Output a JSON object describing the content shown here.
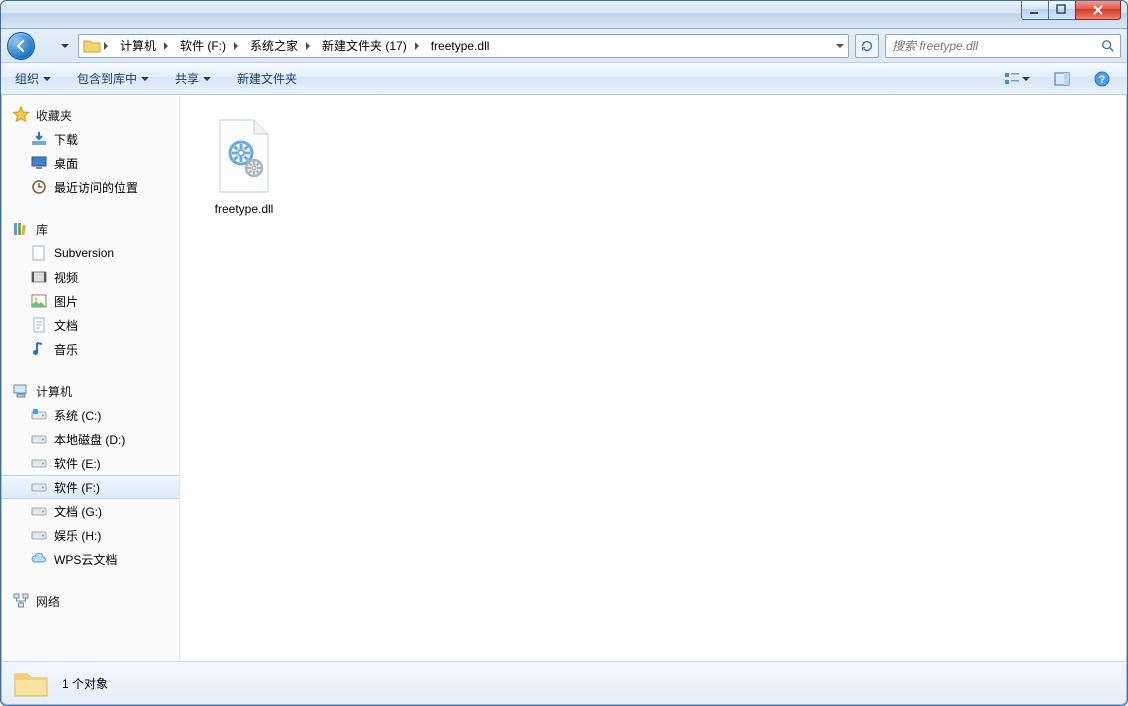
{
  "breadcrumb": [
    "计算机",
    "软件 (F:)",
    "系统之家",
    "新建文件夹 (17)",
    "freetype.dll"
  ],
  "search": {
    "placeholder": "搜索 freetype.dll"
  },
  "toolbar": {
    "organize": "组织",
    "include": "包含到库中",
    "share": "共享",
    "newfolder": "新建文件夹"
  },
  "nav": {
    "favorites": {
      "label": "收藏夹",
      "items": [
        "下载",
        "桌面",
        "最近访问的位置"
      ]
    },
    "libraries": {
      "label": "库",
      "items": [
        "Subversion",
        "视频",
        "图片",
        "文档",
        "音乐"
      ]
    },
    "computer": {
      "label": "计算机",
      "items": [
        "系统 (C:)",
        "本地磁盘 (D:)",
        "软件 (E:)",
        "软件 (F:)",
        "文档 (G:)",
        "娱乐 (H:)",
        "WPS云文档"
      ],
      "selected": 3
    },
    "network": {
      "label": "网络"
    }
  },
  "files": [
    {
      "name": "freetype.dll",
      "type": "dll"
    }
  ],
  "status": {
    "count": "1 个对象"
  }
}
